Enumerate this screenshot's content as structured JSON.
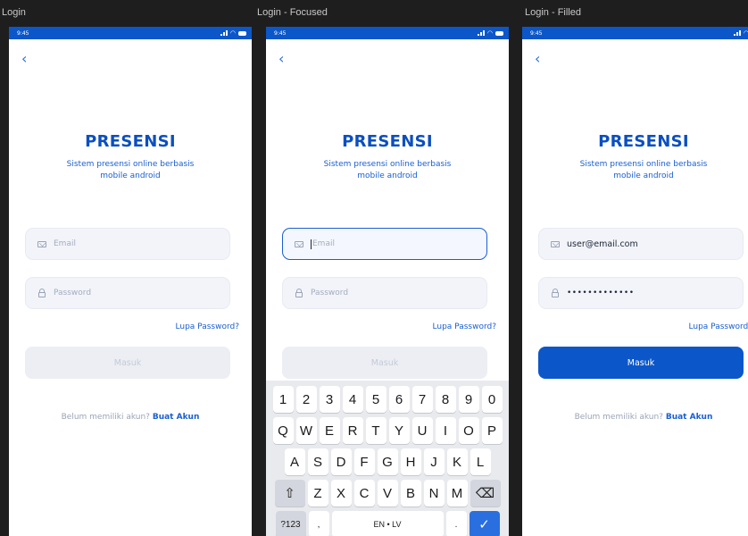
{
  "frames": [
    {
      "label": "Login",
      "status_time": "9:45",
      "brand": "PRESENSI",
      "tagline_line1": "Sistem presensi online berbasis",
      "tagline_line2": "mobile android",
      "email_placeholder": "Email",
      "password_placeholder": "Password",
      "forgot": "Lupa Password?",
      "login_button": "Masuk",
      "signup_text": "Belum memiliki akun?",
      "signup_link": "Buat Akun"
    },
    {
      "label": "Login - Focused",
      "status_time": "9:45",
      "brand": "PRESENSI",
      "tagline_line1": "Sistem presensi online berbasis",
      "tagline_line2": "mobile android",
      "email_placeholder": "Email",
      "password_placeholder": "Password",
      "forgot": "Lupa Password?",
      "login_button": "Masuk"
    },
    {
      "label": "Login - Filled",
      "status_time": "9:45",
      "brand": "PRESENSI",
      "tagline_line1": "Sistem presensi online berbasis",
      "tagline_line2": "mobile android",
      "email_value": "user@email.com",
      "password_value": "•••••••••••••",
      "forgot": "Lupa Password?",
      "login_button": "Masuk",
      "signup_text": "Belum memiliki akun?",
      "signup_link": "Buat Akun"
    }
  ],
  "keyboard": {
    "row1": [
      "1",
      "2",
      "3",
      "4",
      "5",
      "6",
      "7",
      "8",
      "9",
      "0"
    ],
    "row2": [
      "Q",
      "W",
      "E",
      "R",
      "T",
      "Y",
      "U",
      "I",
      "O",
      "P"
    ],
    "row3": [
      "A",
      "S",
      "D",
      "F",
      "G",
      "H",
      "J",
      "K",
      "L"
    ],
    "row4": [
      "Z",
      "X",
      "C",
      "V",
      "B",
      "N",
      "M"
    ],
    "shift": "⇧",
    "backspace": "⌫",
    "symbols": "?123",
    "comma": ",",
    "space": "EN • LV",
    "period": ".",
    "enter": "✓"
  },
  "colors": {
    "primary": "#0b57c9",
    "link": "#1a5fd0",
    "background": "#1e1e1e"
  }
}
